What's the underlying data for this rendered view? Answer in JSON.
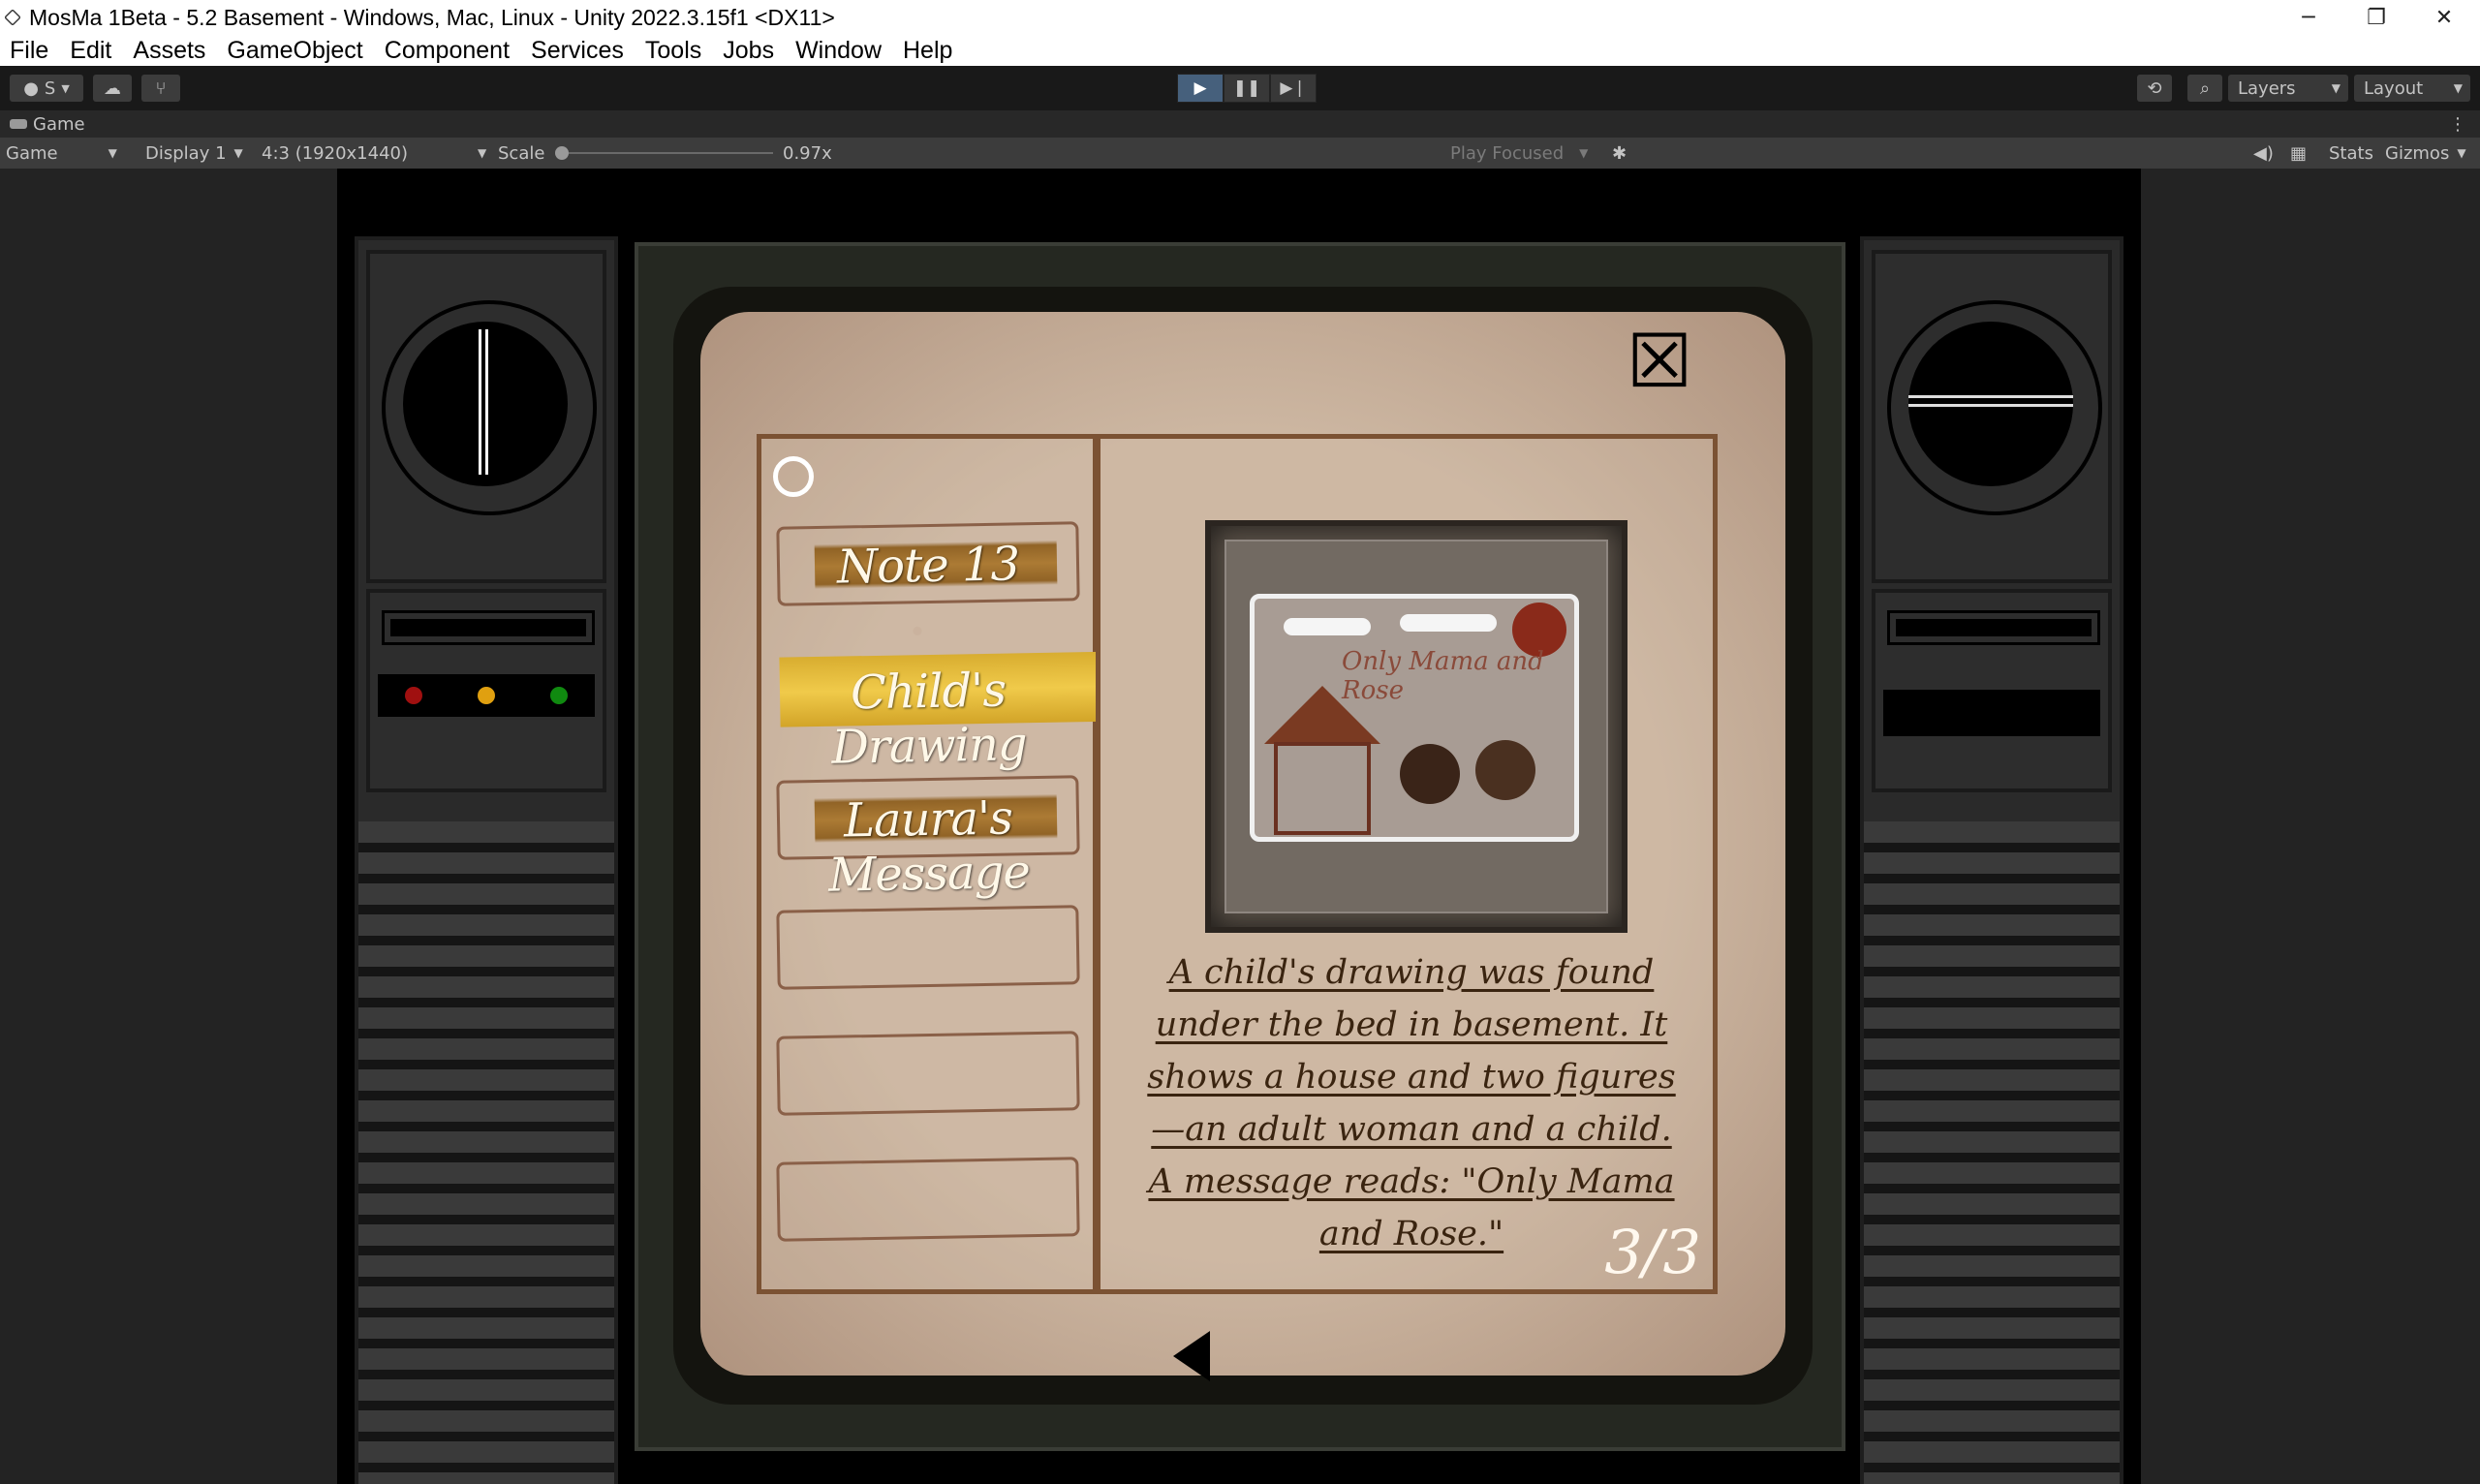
{
  "window": {
    "title": "MosMa 1Beta - 5.2 Basement - Windows, Mac, Linux - Unity 2022.3.15f1 <DX11>",
    "controls": {
      "minimize": "─",
      "maximize": "❐",
      "close": "✕"
    }
  },
  "menu": {
    "items": [
      "File",
      "Edit",
      "Assets",
      "GameObject",
      "Component",
      "Services",
      "Tools",
      "Jobs",
      "Window",
      "Help"
    ]
  },
  "toolbar": {
    "account_label": "S",
    "play": "▶",
    "pause": "❚❚",
    "step": "▶❘",
    "layers_label": "Layers",
    "layout_label": "Layout"
  },
  "tab": {
    "label": "Game"
  },
  "game_bar": {
    "view_mode": "Game",
    "display": "Display 1",
    "aspect": "4:3 (1920x1440)",
    "scale_label": "Scale",
    "scale_value": "0.97x",
    "play_focused": "Play Focused",
    "stats_label": "Stats",
    "gizmos_label": "Gizmos"
  },
  "journal": {
    "close_glyph": "☒",
    "notes": [
      {
        "label": "Note 13",
        "state": "collected"
      },
      {
        "label": "Child's Drawing",
        "state": "selected"
      },
      {
        "label": "Laura's Message",
        "state": "collected"
      },
      {
        "label": "",
        "state": "empty"
      },
      {
        "label": "",
        "state": "empty"
      },
      {
        "label": "",
        "state": "empty"
      }
    ],
    "drawing_caption": "Only Mama and Rose",
    "description": "A child's drawing was found under the bed in basement. It shows a house and two figures—an adult woman and a child. A message reads: \"Only Mama and Rose.\"",
    "page_counter": "3/3"
  },
  "colors": {
    "paper": "#ccb6a1",
    "page_border": "#7b5233",
    "selected_highlight": "#f0ca4a",
    "console_light_red": "#a01010",
    "console_light_amber": "#e0a010",
    "console_light_green": "#108a10"
  }
}
